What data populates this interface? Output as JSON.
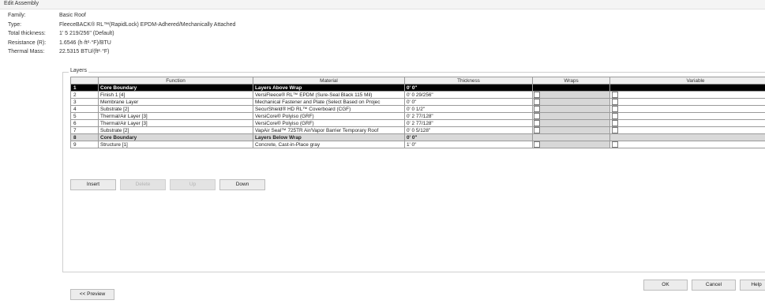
{
  "window": {
    "title": "Edit Assembly"
  },
  "properties": [
    {
      "label": "Family:",
      "value": "Basic Roof"
    },
    {
      "label": "Type:",
      "value": "FleeceBACK® RL™(RapidLock) EPDM-Adhered/Mechanically Attached"
    },
    {
      "label": "Total thickness:",
      "value": "1' 5 219/256\" (Default)"
    },
    {
      "label": "Resistance (R):",
      "value": "1.6546 (h·ft²·°F)/BTU"
    },
    {
      "label": "Thermal Mass:",
      "value": "22.5315 BTU/(ft²·°F)"
    }
  ],
  "layers": {
    "legend": "Layers",
    "columns": [
      "",
      "Function",
      "Material",
      "Thickness",
      "Wraps",
      "Variable"
    ],
    "rows": [
      {
        "num": "1",
        "function": "Core Boundary",
        "material": "Layers Above Wrap",
        "thickness": "0' 0\"",
        "kind": "selected"
      },
      {
        "num": "2",
        "function": "Finish 1 [4]",
        "material": "VersiFleece® RL™ EPDM (Sure-Seal Black 115 Mil)",
        "thickness": "0' 0 29/256\"",
        "kind": "normal"
      },
      {
        "num": "3",
        "function": "Membrane Layer",
        "material": "Mechanical Fastener and Plate (Select Based on Projec",
        "thickness": "0' 0\"",
        "kind": "normal"
      },
      {
        "num": "4",
        "function": "Substrate [2]",
        "material": "SecurShield® HD RL™ Coverboard (CGF)",
        "thickness": "0' 0 1/2\"",
        "kind": "normal"
      },
      {
        "num": "5",
        "function": "Thermal/Air Layer [3]",
        "material": "VersiCore® Polyiso (GRF)",
        "thickness": "0' 2 77/128\"",
        "kind": "normal"
      },
      {
        "num": "6",
        "function": "Thermal/Air Layer [3]",
        "material": "VersiCore® Polyiso (GRF)",
        "thickness": "0' 2 77/128\"",
        "kind": "normal"
      },
      {
        "num": "7",
        "function": "Substrate [2]",
        "material": "VapAir Seal™ 725TR Air/Vapor Barrier Temporary Roof",
        "thickness": "0' 0 5/128\"",
        "kind": "normal"
      },
      {
        "num": "8",
        "function": "Core Boundary",
        "material": "Layers Below Wrap",
        "thickness": "0' 0\"",
        "kind": "core"
      },
      {
        "num": "9",
        "function": "Structure [1]",
        "material": "Concrete, Cast-in-Place gray",
        "thickness": "1' 0\"",
        "kind": "normal"
      }
    ]
  },
  "buttons": {
    "insert": "Insert",
    "delete": "Delete",
    "up": "Up",
    "down": "Down",
    "preview": "<< Preview",
    "ok": "OK",
    "cancel": "Cancel",
    "help": "Help"
  }
}
